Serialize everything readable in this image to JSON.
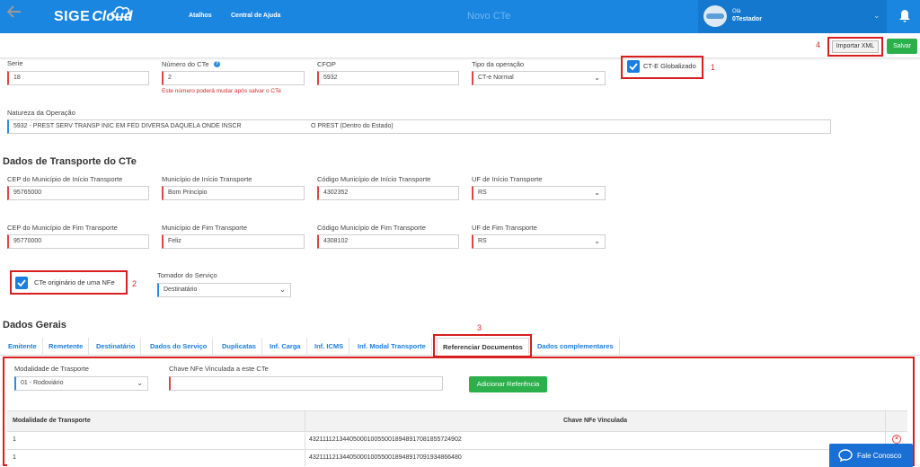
{
  "header": {
    "logo_sige": "SIGE",
    "logo_cloud": "Cloud",
    "nav": [
      "Atalhos",
      "Central de Ajuda"
    ],
    "page_title": "Novo CTe",
    "user_label": "Olá",
    "user_name": "0Testador"
  },
  "toolbar": {
    "importar_label": "Importar XML",
    "salvar_label": "Salvar"
  },
  "annotations": [
    "1",
    "2",
    "3",
    "4"
  ],
  "form": {
    "serie": {
      "label": "Serie",
      "value": "18"
    },
    "numero_cte": {
      "label": "Número do CTe",
      "value": "2",
      "hint": "Este número poderá mudar após salvar o CTe"
    },
    "cfop": {
      "label": "CFOP",
      "value": "5932"
    },
    "tipo_operacao": {
      "label": "Tipo da operação",
      "value": "CT-e Normal"
    },
    "ct_globalizado": {
      "label": "CT-E Globalizado",
      "checked": true
    },
    "natureza": {
      "label": "Natureza da Operação",
      "value": "5932 - PREST SERV TRANSP INIC EM FED DIVERSA DAQUELA ONDE INSCR",
      "value2": "O PREST (Dentro do Estado)"
    }
  },
  "transporte": {
    "title": "Dados de Transporte do CTe",
    "cep_inicio": {
      "label": "CEP do Município de Início Transporte",
      "value": "95765000"
    },
    "mun_inicio": {
      "label": "Município de Início Transporte",
      "value": "Bom Princípio"
    },
    "cod_inicio": {
      "label": "Código Município de Início Transporte",
      "value": "4302352"
    },
    "uf_inicio": {
      "label": "UF de Início Transporte",
      "value": "RS"
    },
    "cep_fim": {
      "label": "CEP do Município de Fim Transporte",
      "value": "95770000"
    },
    "mun_fim": {
      "label": "Município de Fim Transporte",
      "value": "Feliz"
    },
    "cod_fim": {
      "label": "Código Município de Fim Transporte",
      "value": "4308102"
    },
    "uf_fim": {
      "label": "UF de Fim Transporte",
      "value": "RS"
    },
    "origem_nfe": {
      "label": "CTe originário de uma NFe",
      "checked": true
    },
    "tomador": {
      "label": "Tomador do Serviço",
      "value": "Destinatário"
    }
  },
  "dados_gerais": {
    "title": "Dados Gerais",
    "tabs": [
      "Emitente",
      "Remetente",
      "Destinatário",
      "Dados do Serviço",
      "Duplicatas",
      "Inf. Carga",
      "Inf. ICMS",
      "Inf. Modal Transporte",
      "Referenciar Documentos",
      "Dados complementares"
    ],
    "active_tab": "Referenciar Documentos"
  },
  "referenciar": {
    "modalidade": {
      "label": "Modalidade de Trasporte",
      "value": "01 - Rodoviário"
    },
    "chave": {
      "label": "Chave NFe Vinculada a este CTe",
      "value": ""
    },
    "add_button": "Adicionar Referência",
    "table": {
      "headers": [
        "Modalidade de Transporte",
        "Chave NFe Vinculada"
      ],
      "rows": [
        [
          "1",
          "43211112134405000100550018948917081855724902"
        ],
        [
          "1",
          "43211112134405000100550018948917091934866480"
        ]
      ]
    }
  },
  "chat": {
    "label": "Fale Conosco"
  }
}
